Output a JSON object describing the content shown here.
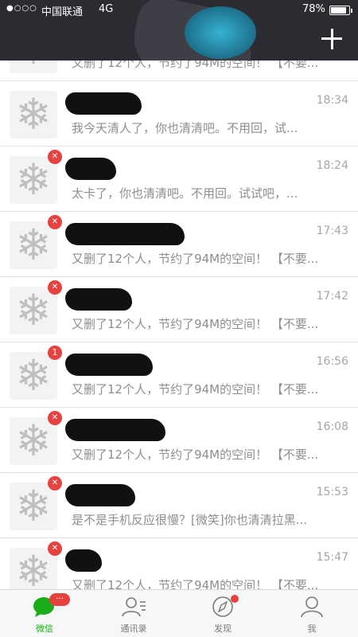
{
  "status_bar": {
    "signal": "●○○○",
    "carrier": "中国联通",
    "network": "4G",
    "battery": "78%",
    "battery_level_percent": 78
  },
  "nav": {
    "add_icon": "plus-icon"
  },
  "chats": [
    {
      "time": "",
      "preview": "又删了12个人，节约了94M的空间！ 【不要..."
    },
    {
      "time": "18:34",
      "preview": "我今天清人了，你也清清吧。不用回，试..."
    },
    {
      "time": "18:24",
      "preview": "太卡了，你也清清吧。不用回。试试吧，..."
    },
    {
      "time": "17:43",
      "preview": "又删了12个人，节约了94M的空间！ 【不要..."
    },
    {
      "time": "17:42",
      "preview": "又删了12个人，节约了94M的空间！ 【不要..."
    },
    {
      "time": "16:56",
      "preview": "又删了12个人，节约了94M的空间！ 【不要...",
      "badge": "1"
    },
    {
      "time": "16:08",
      "preview": "又删了12个人，节约了94M的空间！ 【不要..."
    },
    {
      "time": "15:53",
      "preview": "是不是手机反应很慢？[微笑]你也清清拉黑..."
    },
    {
      "time": "15:47",
      "preview": "又删了12个人，节约了94M的空间！ 【不要..."
    }
  ],
  "tabs": [
    {
      "label": "微信",
      "icon": "chat-bubble-icon",
      "badge": "···"
    },
    {
      "label": "通讯录",
      "icon": "contacts-icon"
    },
    {
      "label": "发现",
      "icon": "compass-icon"
    },
    {
      "label": "我",
      "icon": "person-icon"
    }
  ],
  "colors": {
    "header": "#2b2b31",
    "accent": "#1aad19",
    "badge": "#e64340"
  }
}
